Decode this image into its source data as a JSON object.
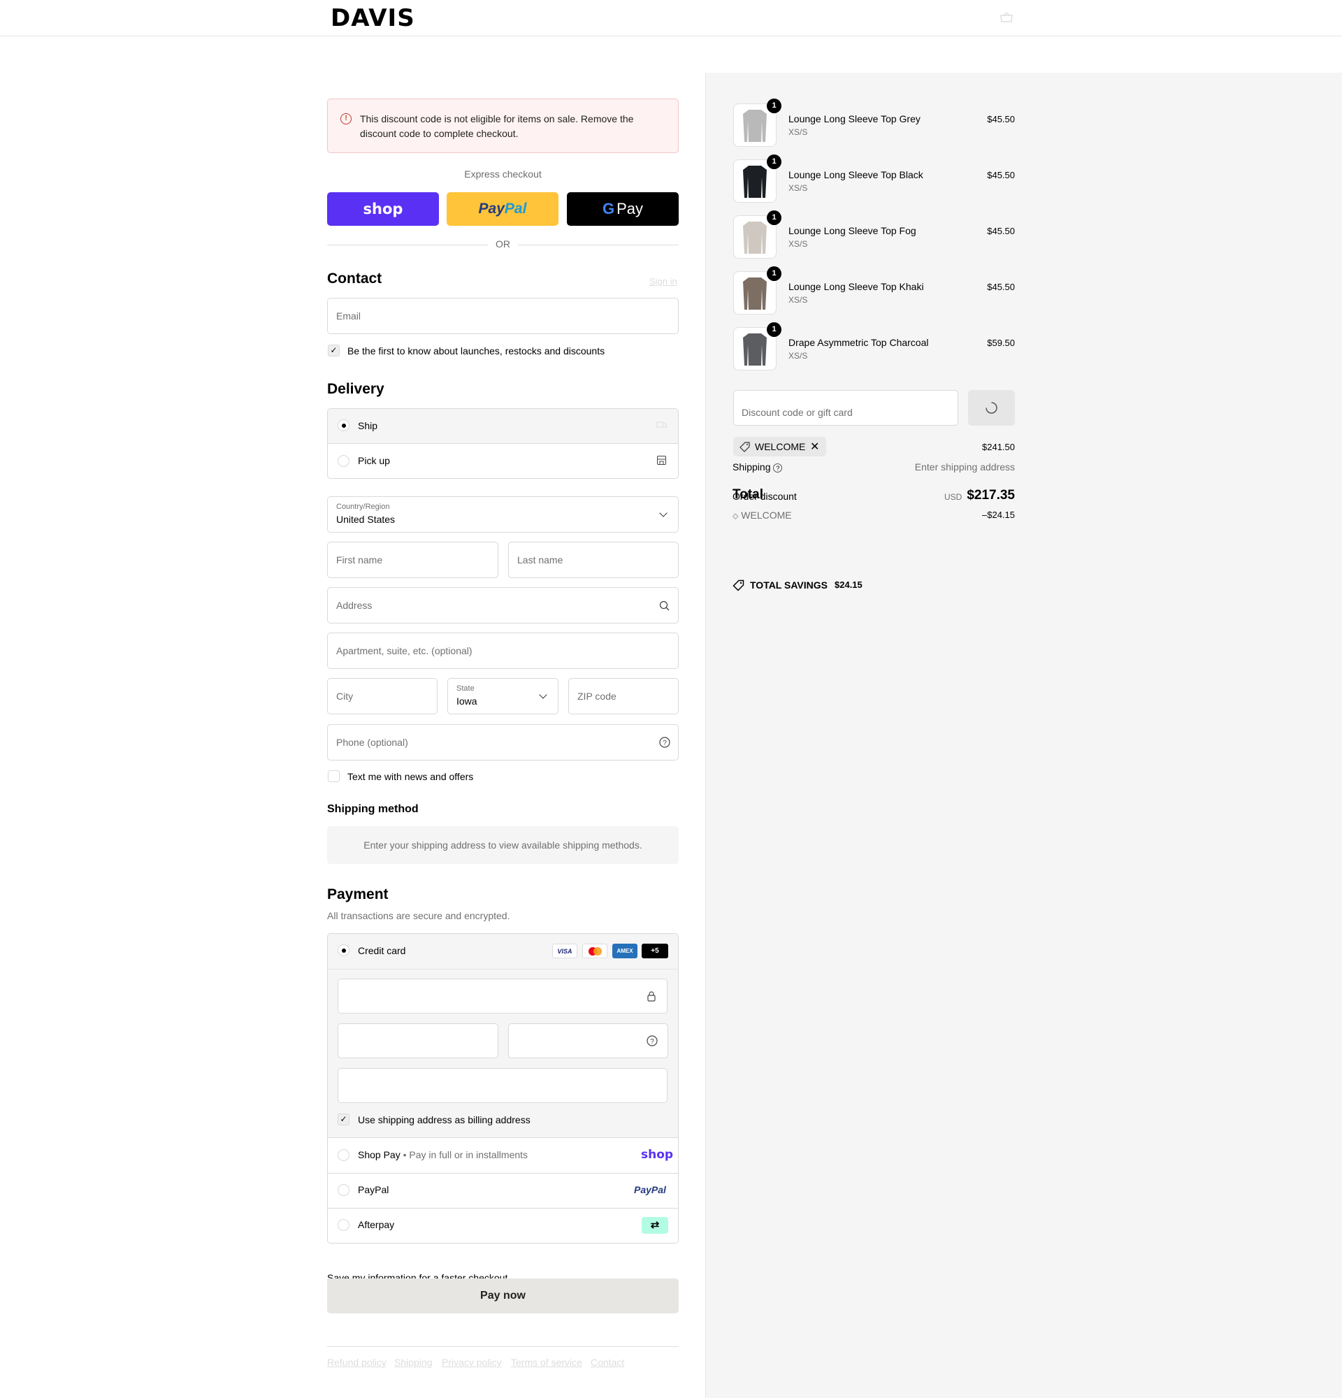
{
  "header": {
    "logo": "DAVIS"
  },
  "alert": {
    "text": "This discount code is not eligible for items on sale. Remove the discount code to complete checkout."
  },
  "express": {
    "label": "Express checkout",
    "shop": "shop",
    "paypal_pay": "Pay",
    "paypal_pal": "Pal",
    "gpay": "Pay",
    "or": "OR"
  },
  "contact": {
    "title": "Contact",
    "sign_in": "Sign in",
    "email_placeholder": "Email",
    "marketing": "Be the first to know about launches, restocks and discounts"
  },
  "delivery": {
    "title": "Delivery",
    "ship": "Ship",
    "pickup": "Pick up",
    "country_label": "Country/Region",
    "country_value": "United States",
    "first_name": "First name",
    "last_name": "Last name",
    "address": "Address",
    "apartment": "Apartment, suite, etc. (optional)",
    "city": "City",
    "state_label": "State",
    "state_value": "Iowa",
    "zip": "ZIP code",
    "phone": "Phone (optional)",
    "text_me": "Text me with news and offers"
  },
  "shipping_method": {
    "title": "Shipping method",
    "notice": "Enter your shipping address to view available shipping methods."
  },
  "payment": {
    "title": "Payment",
    "subtitle": "All transactions are secure and encrypted.",
    "credit_card": "Credit card",
    "badges": {
      "visa": "VISA",
      "amex": "AMEX",
      "more": "+5"
    },
    "billing_same": "Use shipping address as billing address",
    "shop_pay": "Shop Pay",
    "shop_pay_desc": "Pay in full or in installments",
    "shop_pay_logo": "shop",
    "paypal": "PayPal",
    "paypal_logo": "PayPal",
    "afterpay": "Afterpay",
    "save_info": "Save my information for a faster checkout",
    "pay_now": "Pay now"
  },
  "footer": {
    "links": [
      "Refund policy",
      "Shipping",
      "Privacy policy",
      "Terms of service",
      "Contact"
    ]
  },
  "summary": {
    "items": [
      {
        "name": "Lounge Long Sleeve Top Grey",
        "variant": "XS/S",
        "price": "$45.50",
        "qty": "1",
        "color": "#b9b9b9"
      },
      {
        "name": "Lounge Long Sleeve Top Black",
        "variant": "XS/S",
        "price": "$45.50",
        "qty": "1",
        "color": "#1c1f24"
      },
      {
        "name": "Lounge Long Sleeve Top Fog",
        "variant": "XS/S",
        "price": "$45.50",
        "qty": "1",
        "color": "#cfc8c0"
      },
      {
        "name": "Lounge Long Sleeve Top Khaki",
        "variant": "XS/S",
        "price": "$45.50",
        "qty": "1",
        "color": "#7d6e63"
      },
      {
        "name": "Drape Asymmetric Top Charcoal",
        "variant": "XS/S",
        "price": "$59.50",
        "qty": "1",
        "color": "#5c5d60"
      }
    ],
    "discount_placeholder": "Discount code or gift card",
    "applied_code": "WELCOME",
    "subtotal_value": "$241.50",
    "shipping_label": "Shipping",
    "shipping_value": "Enter shipping address",
    "total_label": "Total",
    "currency": "USD",
    "total_value": "$217.35",
    "order_discount_label": "Order discount",
    "discount_code": "WELCOME",
    "discount_value": "–$24.15",
    "savings_label": "TOTAL SAVINGS",
    "savings_value": "$24.15"
  }
}
